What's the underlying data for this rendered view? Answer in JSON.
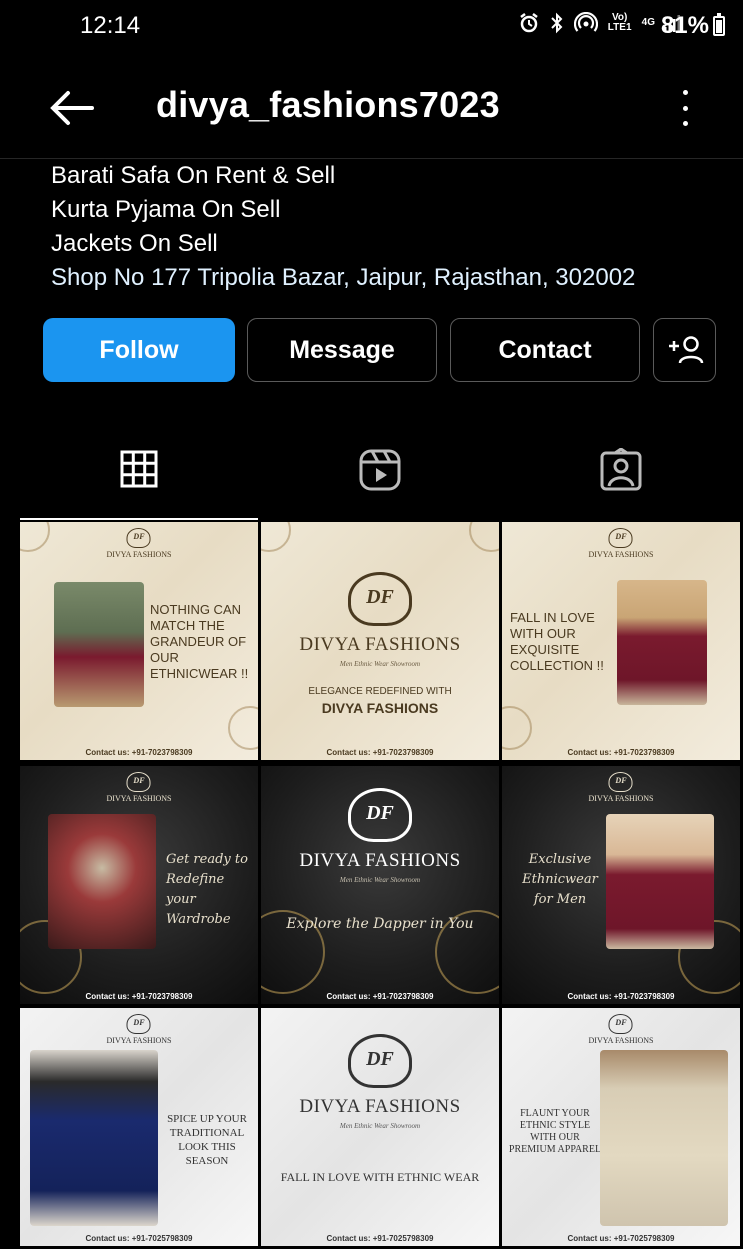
{
  "status_bar": {
    "time": "12:14",
    "network_lte": "Vo) LTE1",
    "network_4g": "4G",
    "battery_percent": "81%",
    "battery_level": 0.81,
    "icons": [
      "alarm-icon",
      "bluetooth-icon",
      "hotspot-icon",
      "signal-icon",
      "battery-icon"
    ]
  },
  "header": {
    "username": "divya_fashions7023",
    "back_icon": "arrow-left-icon",
    "menu_icon": "more-vertical-icon"
  },
  "bio": {
    "lines": [
      "Barati Safa On Rent & Sell",
      "Kurta Pyjama On Sell",
      "Jackets On Sell"
    ],
    "address": "Shop No 177 Tripolia Bazar, Jaipur, Rajasthan, 302002"
  },
  "actions": {
    "follow": "Follow",
    "message": "Message",
    "contact": "Contact",
    "add_user_icon": "add-person-icon"
  },
  "tabs": {
    "posts_icon": "grid-icon",
    "reels_icon": "reels-icon",
    "tagged_icon": "tagged-person-icon",
    "active": "posts"
  },
  "posts": {
    "brand_small": "DIVYA FASHIONS",
    "brand_big": "DIVYA FASHIONS",
    "logo_mark": "DF",
    "logo_tagline": "Men Ethnic Wear Showroom",
    "contact": "Contact us: +91-7023798309",
    "contact_alt": "Contact us: +91-7025798309",
    "p1_text": "NOTHING CAN MATCH THE GRANDEUR OF OUR ETHNICWEAR !!",
    "p2_line1": "ELEGANCE REDEFINED WITH",
    "p2_line2": "DIVYA FASHIONS",
    "p3_text": "FALL IN LOVE WITH OUR EXQUISITE COLLECTION !!",
    "p4_text": "Get ready to Redefine your Wardrobe",
    "p5_text": "Explore the Dapper in You",
    "p6_text": "Exclusive Ethnicwear for Men",
    "p7_text": "SPICE UP YOUR TRADITIONAL LOOK THIS SEASON",
    "p8_text": "FALL IN LOVE WITH ETHNIC WEAR",
    "p9_text": "FLAUNT YOUR ETHNIC STYLE WITH OUR PREMIUM APPAREL"
  }
}
